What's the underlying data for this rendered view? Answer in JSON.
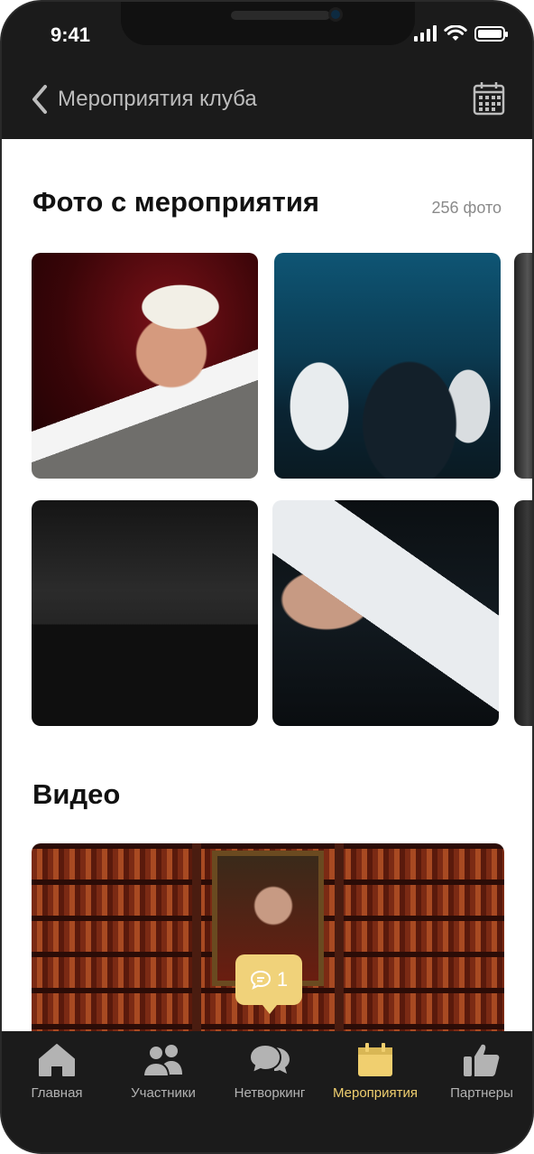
{
  "status_bar": {
    "time": "9:41"
  },
  "header": {
    "back_label": "Мероприятия клуба"
  },
  "photos_section": {
    "title": "Фото с мероприятия",
    "count": "256 фото"
  },
  "video_section": {
    "title": "Видео",
    "comment_count": "1"
  },
  "tabbar": {
    "items": [
      {
        "label": "Главная",
        "icon": "home-icon"
      },
      {
        "label": "Участники",
        "icon": "users-icon"
      },
      {
        "label": "Нетворкинг",
        "icon": "chat-icon"
      },
      {
        "label": "Мероприятия",
        "icon": "calendar-icon",
        "active": true
      },
      {
        "label": "Партнеры",
        "icon": "thumbs-up-icon"
      }
    ]
  },
  "colors": {
    "accent": "#f0cf6f",
    "dark": "#1b1b1b"
  }
}
